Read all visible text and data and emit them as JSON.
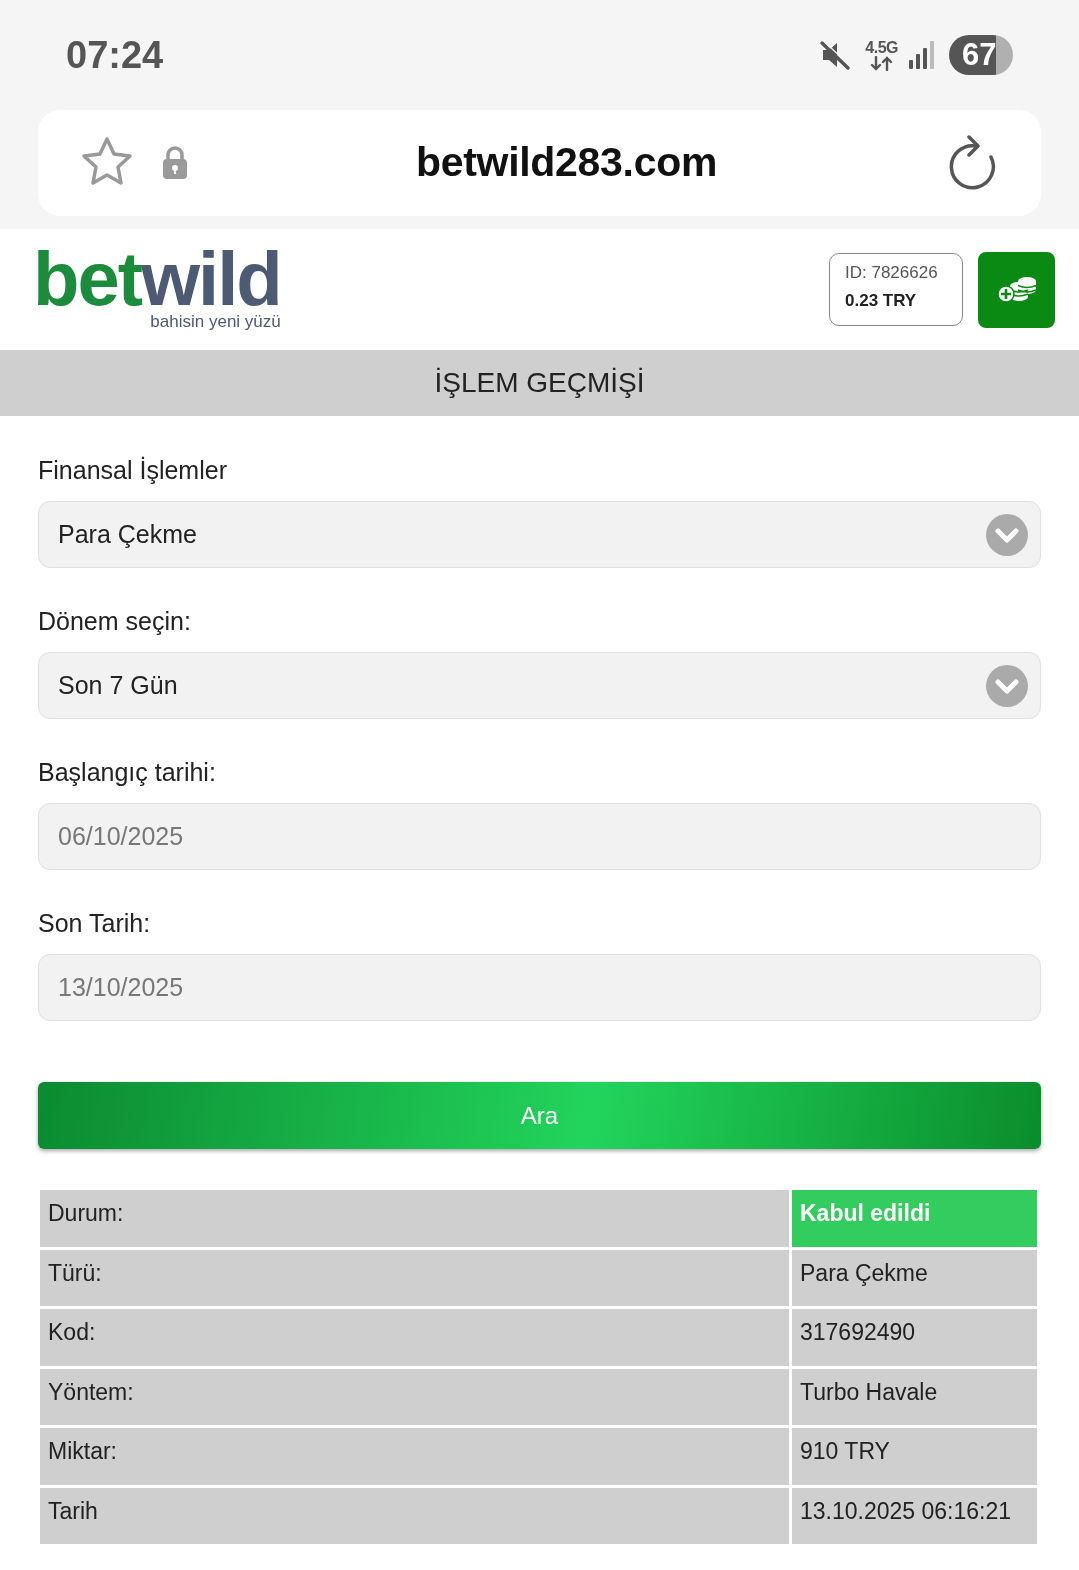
{
  "status_bar": {
    "time": "07:24",
    "network": "4.5G",
    "battery": "67"
  },
  "browser": {
    "url": "betwild283.com"
  },
  "header": {
    "logo": {
      "parts": [
        "bet",
        "wild"
      ],
      "tagline": "bahisin yeni yüzü"
    },
    "account": {
      "id": "ID: 7826626",
      "balance": "0.23 TRY"
    }
  },
  "page_title": "İŞLEM GEÇMİŞİ",
  "form": {
    "fields": [
      {
        "kind": "select",
        "label": "Finansal İşlemler",
        "value": "Para Çekme",
        "disabled": false
      },
      {
        "kind": "select",
        "label": "Dönem seçin:",
        "value": "Son 7 Gün",
        "disabled": false
      },
      {
        "kind": "date",
        "label": "Başlangıç tarihi:",
        "value": "06/10/2025",
        "disabled": true
      },
      {
        "kind": "date",
        "label": "Son Tarih:",
        "value": "13/10/2025",
        "disabled": true
      }
    ],
    "submit": "Ara"
  },
  "results": {
    "rows": [
      {
        "label": "Durum:",
        "value": "Kabul edildi",
        "kind": "status"
      },
      {
        "label": "Türü:",
        "value": "Para Çekme",
        "kind": "text"
      },
      {
        "label": "Kod:",
        "value": "317692490",
        "kind": "text"
      },
      {
        "label": "Yöntem:",
        "value": "Turbo Havale",
        "kind": "text"
      },
      {
        "label": "Miktar:",
        "value": "910 TRY",
        "kind": "text"
      },
      {
        "label": "Tarih",
        "value": "13.10.2025 06:16:21",
        "kind": "text"
      }
    ]
  }
}
